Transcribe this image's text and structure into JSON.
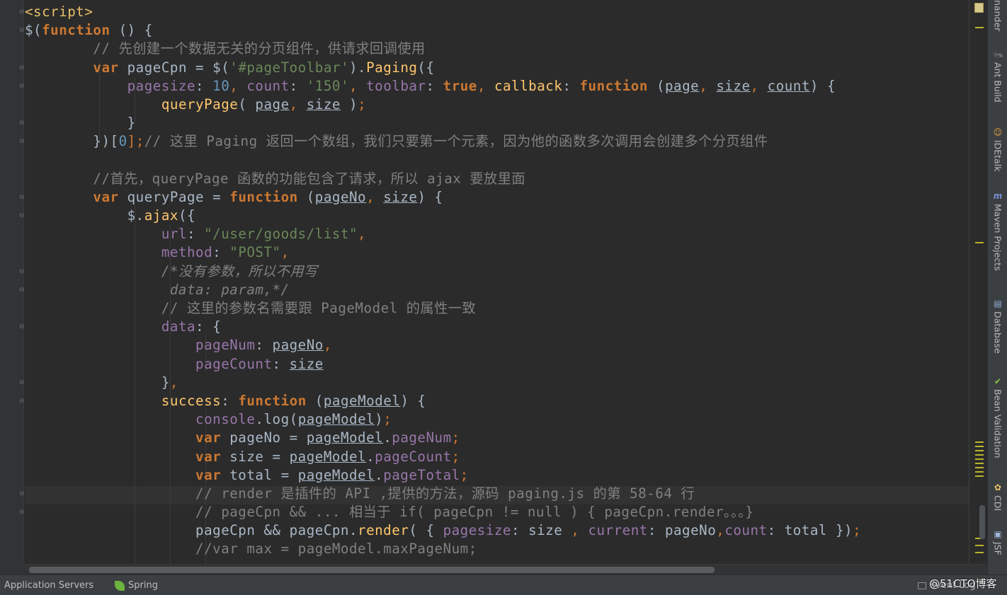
{
  "editor": {
    "file_language": "JavaScript in HTML",
    "lines": [
      [
        {
          "t": "<script>",
          "c": "tag"
        }
      ],
      [
        {
          "t": "$(",
          "c": "def"
        },
        {
          "t": "function",
          "c": "kw"
        },
        {
          "t": " () {",
          "c": "def"
        }
      ],
      [
        {
          "t": "        // 先创建一个数据无关的分页组件，供请求回调使用",
          "c": "cmt"
        }
      ],
      [
        {
          "t": "        ",
          "c": "def"
        },
        {
          "t": "var",
          "c": "kw"
        },
        {
          "t": " pageCpn = $(",
          "c": "def"
        },
        {
          "t": "'#pageToolbar'",
          "c": "str"
        },
        {
          "t": ").",
          "c": "def"
        },
        {
          "t": "Paging",
          "c": "fn"
        },
        {
          "t": "({",
          "c": "def"
        }
      ],
      [
        {
          "t": "            ",
          "c": "def"
        },
        {
          "t": "pagesize",
          "c": "prop"
        },
        {
          "t": ": ",
          "c": "def"
        },
        {
          "t": "10",
          "c": "num"
        },
        {
          "t": ", ",
          "c": "pun"
        },
        {
          "t": "count",
          "c": "prop"
        },
        {
          "t": ": ",
          "c": "def"
        },
        {
          "t": "'150'",
          "c": "str"
        },
        {
          "t": ", ",
          "c": "pun"
        },
        {
          "t": "toolbar",
          "c": "prop"
        },
        {
          "t": ": ",
          "c": "def"
        },
        {
          "t": "true",
          "c": "kw"
        },
        {
          "t": ", ",
          "c": "pun"
        },
        {
          "t": "callback",
          "c": "fn"
        },
        {
          "t": ": ",
          "c": "def"
        },
        {
          "t": "function",
          "c": "kw"
        },
        {
          "t": " (",
          "c": "def"
        },
        {
          "t": "page",
          "c": "par"
        },
        {
          "t": ", ",
          "c": "pun"
        },
        {
          "t": "size",
          "c": "par"
        },
        {
          "t": ", ",
          "c": "pun"
        },
        {
          "t": "count",
          "c": "par"
        },
        {
          "t": ") {",
          "c": "def"
        }
      ],
      [
        {
          "t": "                ",
          "c": "def"
        },
        {
          "t": "queryPage",
          "c": "fn"
        },
        {
          "t": "( ",
          "c": "def"
        },
        {
          "t": "page",
          "c": "par"
        },
        {
          "t": ", ",
          "c": "pun"
        },
        {
          "t": "size",
          "c": "par"
        },
        {
          "t": " )",
          "c": "def"
        },
        {
          "t": ";",
          "c": "pun"
        }
      ],
      [
        {
          "t": "            }",
          "c": "def"
        }
      ],
      [
        {
          "t": "        })[",
          "c": "def"
        },
        {
          "t": "0",
          "c": "num"
        },
        {
          "t": "];",
          "c": "pun"
        },
        {
          "t": "// 这里 Paging 返回一个数组，我们只要第一个元素，因为他的函数多次调用会创建多个分页组件",
          "c": "cmt"
        }
      ],
      [
        {
          "t": "",
          "c": "def"
        }
      ],
      [
        {
          "t": "        //首先，queryPage 函数的功能包含了请求，所以 ajax 要放里面",
          "c": "cmt"
        }
      ],
      [
        {
          "t": "        ",
          "c": "def"
        },
        {
          "t": "var",
          "c": "kw"
        },
        {
          "t": " queryPage = ",
          "c": "def"
        },
        {
          "t": "function",
          "c": "kw"
        },
        {
          "t": " (",
          "c": "def"
        },
        {
          "t": "pageNo",
          "c": "par"
        },
        {
          "t": ", ",
          "c": "pun"
        },
        {
          "t": "size",
          "c": "par"
        },
        {
          "t": ") {",
          "c": "def"
        }
      ],
      [
        {
          "t": "            $.",
          "c": "def"
        },
        {
          "t": "ajax",
          "c": "fn"
        },
        {
          "t": "({",
          "c": "def"
        }
      ],
      [
        {
          "t": "                ",
          "c": "def"
        },
        {
          "t": "url",
          "c": "prop"
        },
        {
          "t": ": ",
          "c": "def"
        },
        {
          "t": "\"/user/goods/list\"",
          "c": "str"
        },
        {
          "t": ",",
          "c": "pun"
        }
      ],
      [
        {
          "t": "                ",
          "c": "def"
        },
        {
          "t": "method",
          "c": "prop"
        },
        {
          "t": ": ",
          "c": "def"
        },
        {
          "t": "\"POST\"",
          "c": "str"
        },
        {
          "t": ",",
          "c": "pun"
        }
      ],
      [
        {
          "t": "                /*没有参数，所以不用写",
          "c": "icmt"
        }
      ],
      [
        {
          "t": "                 data: param,*/",
          "c": "icmt"
        }
      ],
      [
        {
          "t": "                // 这里的参数名需要跟 PageModel 的属性一致",
          "c": "cmt"
        }
      ],
      [
        {
          "t": "                ",
          "c": "def"
        },
        {
          "t": "data",
          "c": "prop"
        },
        {
          "t": ": {",
          "c": "def"
        }
      ],
      [
        {
          "t": "                    ",
          "c": "def"
        },
        {
          "t": "pageNum",
          "c": "prop"
        },
        {
          "t": ": ",
          "c": "def"
        },
        {
          "t": "pageNo",
          "c": "par"
        },
        {
          "t": ",",
          "c": "pun"
        }
      ],
      [
        {
          "t": "                    ",
          "c": "def"
        },
        {
          "t": "pageCount",
          "c": "prop"
        },
        {
          "t": ": ",
          "c": "def"
        },
        {
          "t": "size",
          "c": "par"
        }
      ],
      [
        {
          "t": "                }",
          "c": "def"
        },
        {
          "t": ",",
          "c": "pun"
        }
      ],
      [
        {
          "t": "                ",
          "c": "def"
        },
        {
          "t": "success",
          "c": "fn"
        },
        {
          "t": ": ",
          "c": "def"
        },
        {
          "t": "function",
          "c": "kw"
        },
        {
          "t": " (",
          "c": "def"
        },
        {
          "t": "pageModel",
          "c": "par"
        },
        {
          "t": ") {",
          "c": "def"
        }
      ],
      [
        {
          "t": "                    ",
          "c": "def"
        },
        {
          "t": "console",
          "c": "prop"
        },
        {
          "t": ".",
          "c": "def"
        },
        {
          "t": "log",
          "c": "def"
        },
        {
          "t": "(",
          "c": "def"
        },
        {
          "t": "pageModel",
          "c": "par"
        },
        {
          "t": ")",
          "c": "def"
        },
        {
          "t": ";",
          "c": "pun"
        }
      ],
      [
        {
          "t": "                    ",
          "c": "def"
        },
        {
          "t": "var",
          "c": "kw"
        },
        {
          "t": " pageNo = ",
          "c": "def"
        },
        {
          "t": "pageModel",
          "c": "par"
        },
        {
          "t": ".",
          "c": "def"
        },
        {
          "t": "pageNum",
          "c": "prop"
        },
        {
          "t": ";",
          "c": "pun"
        }
      ],
      [
        {
          "t": "                    ",
          "c": "def"
        },
        {
          "t": "var",
          "c": "kw"
        },
        {
          "t": " size = ",
          "c": "def"
        },
        {
          "t": "pageModel",
          "c": "par"
        },
        {
          "t": ".",
          "c": "def"
        },
        {
          "t": "pageCount",
          "c": "prop"
        },
        {
          "t": ";",
          "c": "pun"
        }
      ],
      [
        {
          "t": "                    ",
          "c": "def"
        },
        {
          "t": "var",
          "c": "kw"
        },
        {
          "t": " total = ",
          "c": "def"
        },
        {
          "t": "pageModel",
          "c": "par"
        },
        {
          "t": ".",
          "c": "def"
        },
        {
          "t": "pageTotal",
          "c": "prop"
        },
        {
          "t": ";",
          "c": "pun"
        }
      ],
      [
        {
          "t": "                    // render 是插件的 API ,提供的方法，源码 paging.js 的第 58-64 行",
          "c": "cmt"
        }
      ],
      [
        {
          "t": "                    // pageCpn && ... 相当于 if( pageCpn != null ) { pageCpn.render。。。}",
          "c": "cmt"
        }
      ],
      [
        {
          "t": "                    pageCpn && pageCpn.",
          "c": "def"
        },
        {
          "t": "render",
          "c": "fn"
        },
        {
          "t": "( { ",
          "c": "def"
        },
        {
          "t": "pagesize",
          "c": "prop"
        },
        {
          "t": ": size ",
          "c": "def"
        },
        {
          "t": ", ",
          "c": "pun"
        },
        {
          "t": "current",
          "c": "prop"
        },
        {
          "t": ": pageNo",
          "c": "def"
        },
        {
          "t": ",",
          "c": "pun"
        },
        {
          "t": "count",
          "c": "prop"
        },
        {
          "t": ": total })",
          "c": "def"
        },
        {
          "t": ";",
          "c": "pun"
        }
      ],
      [
        {
          "t": "                    //var max = pageModel.maxPageNum;",
          "c": "cmt"
        }
      ]
    ]
  },
  "right_tools": [
    {
      "label": "nander",
      "icon": "commander-icon"
    },
    {
      "label": "Ant Build",
      "icon": "ant-icon",
      "glyph": "🐜"
    },
    {
      "label": "IDEtalk",
      "icon": "idetalk-icon",
      "glyph": "☺"
    },
    {
      "label": "Maven Projects",
      "icon": "maven-icon",
      "glyph": "m"
    },
    {
      "label": "Database",
      "icon": "database-icon",
      "glyph": "▤"
    },
    {
      "label": "Bean Validation",
      "icon": "bean-validation-icon",
      "glyph": "✔"
    },
    {
      "label": "CDI",
      "icon": "cdi-icon",
      "glyph": "✿"
    },
    {
      "label": "JSF",
      "icon": "jsf-icon",
      "glyph": "▣"
    }
  ],
  "bottom_bar": {
    "app_servers": "Application Servers",
    "spring": "Spring",
    "event_log": "Event Log",
    "watermark": "@51CTO博客"
  },
  "colors": {
    "background": "#2b2b2b",
    "keyword": "#cc7832",
    "string": "#6a8759",
    "number": "#6897bb",
    "comment": "#808080",
    "property": "#9876aa",
    "function": "#ffc66d",
    "default": "#a9b7c6"
  }
}
